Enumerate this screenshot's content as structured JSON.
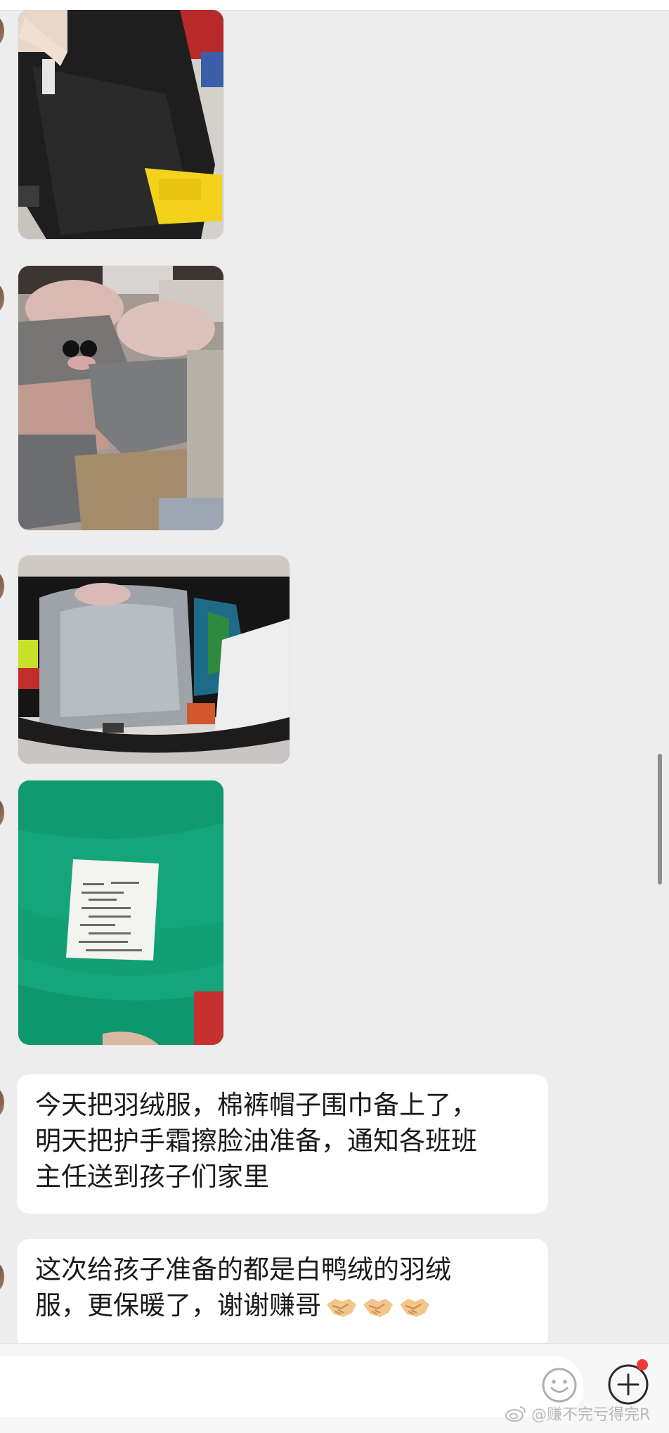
{
  "messages": [
    {
      "type": "image",
      "name": "photo-black-pants"
    },
    {
      "type": "image",
      "name": "photo-bagged-clothes"
    },
    {
      "type": "image",
      "name": "photo-car-trunk"
    },
    {
      "type": "image",
      "name": "photo-green-jacket-label"
    },
    {
      "type": "text",
      "lines": [
        "今天把羽绒服，棉裤帽子围巾备上了，",
        "明天把护手霜擦脸油准备，通知各班班",
        "主任送到孩子们家里"
      ]
    },
    {
      "type": "text",
      "lines": [
        "这次给孩子准备的都是白鸭绒的羽绒",
        "服，更保暖了，谢谢赚哥"
      ],
      "emoji": [
        "handshake",
        "handshake",
        "handshake"
      ]
    }
  ],
  "input": {
    "placeholder": ""
  },
  "icons": {
    "emoji_button": "smiley-icon",
    "more_button": "plus-circle-icon",
    "notification": "red-dot"
  },
  "colors": {
    "background": "#ededed",
    "bubble": "#ffffff",
    "badge": "#f23a35"
  },
  "watermark": {
    "text": "@赚不完亏得完R"
  }
}
